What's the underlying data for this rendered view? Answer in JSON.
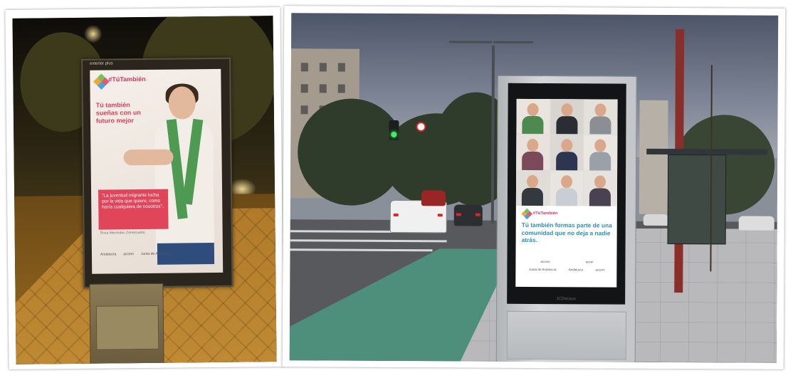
{
  "left_photo": {
    "advert": {
      "brand_strip": "exterior plus",
      "hashtag": "#TúTambién",
      "headline": "Tú también sueñas con un futuro mejor",
      "quote": "\"La juventud migrante lucha por la vida que quiere, como haría cualquiera de nosotros\".",
      "quote_author": "Rosa Mercedes (Venezuela)",
      "sponsors": [
        "Andalucía",
        "accem",
        "Junta de Andalucía"
      ]
    }
  },
  "right_photo": {
    "advert": {
      "hashtag": "#TúTambién",
      "headline": "Tú también formas parte de una comunidad que no deja a nadie atrás.",
      "sponsors_row1": [
        "accem",
        "acem"
      ],
      "sponsors_row2": [
        "Junta de Andalucía",
        "Andalucía",
        "accem"
      ]
    },
    "kiosk_brand": "JCDecaux"
  },
  "colors": {
    "campaign_pink": "#d43a6a",
    "campaign_blue": "#2a8fb5",
    "quote_red": "#e0455a",
    "traffic_green": "#3ef05a"
  }
}
